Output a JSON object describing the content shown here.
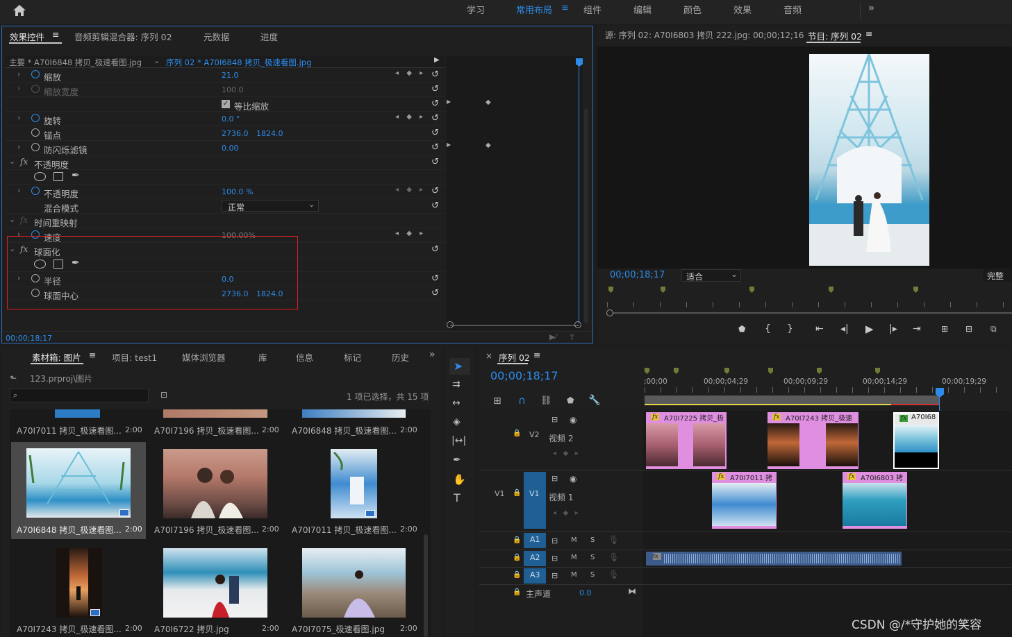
{
  "topbar": {
    "home": "home-icon",
    "workspaces": [
      "学习",
      "常用布局",
      "组件",
      "编辑",
      "颜色",
      "效果",
      "音频"
    ],
    "active": "常用布局",
    "more": "»"
  },
  "effects": {
    "tabs": [
      "效果控件",
      "音频剪辑混合器: 序列 02",
      "元数据",
      "进度"
    ],
    "master": "主要 * A70I6848 拷贝_极速看图.jpg",
    "seq": "序列 02 * A70I6848 拷贝_极速看图.jpg",
    "rows": [
      {
        "label": "缩放",
        "v1": "21.0",
        "v2": ""
      },
      {
        "label": "缩放宽度",
        "v1": "100.0",
        "v2": ""
      },
      {
        "label": "等比缩放",
        "v1": "",
        "v2": ""
      },
      {
        "label": "旋转",
        "v1": "0.0 °",
        "v2": ""
      },
      {
        "label": "锚点",
        "v1": "2736.0",
        "v2": "1824.0"
      },
      {
        "label": "防闪烁滤镜",
        "v1": "0.00",
        "v2": ""
      },
      {
        "label": "不透明度",
        "v1": "",
        "v2": ""
      },
      {
        "label": "",
        "v1": "",
        "v2": ""
      },
      {
        "label": "不透明度",
        "v1": "100.0 %",
        "v2": ""
      },
      {
        "label": "混合模式",
        "v1": "正常",
        "v2": ""
      },
      {
        "label": "时间重映射",
        "v1": "",
        "v2": ""
      },
      {
        "label": "速度",
        "v1": "100.00%",
        "v2": ""
      },
      {
        "label": "球面化",
        "v1": "",
        "v2": ""
      },
      {
        "label": "",
        "v1": "",
        "v2": ""
      },
      {
        "label": "半径",
        "v1": "0.0",
        "v2": ""
      },
      {
        "label": "球面中心",
        "v1": "2736.0",
        "v2": "1824.0"
      }
    ],
    "timecode": "00;00;18;17"
  },
  "source": {
    "title": "源: 序列 02: A70I6803 拷贝 222.jpg: 00;00;12;16"
  },
  "program": {
    "tab": "节目: 序列 02",
    "timecode": "00;00;18;17",
    "fit": "适合",
    "quality": "完整"
  },
  "bin": {
    "tabs": [
      "素材箱: 图片",
      "项目: test1",
      "媒体浏览器",
      "库",
      "信息",
      "标记",
      "历史"
    ],
    "path": "123.prproj\\图片",
    "status": "1 项已选择，共 15 项",
    "items": [
      {
        "name": "A70I7011 拷贝_极速看图...",
        "dur": "2:00"
      },
      {
        "name": "A70I7196 拷贝_极速看图...",
        "dur": "2:00"
      },
      {
        "name": "A70I6848 拷贝_极速看图...",
        "dur": "2:00"
      },
      {
        "name": "A70I6848 拷贝_极速看图...",
        "dur": "2:00"
      },
      {
        "name": "A70I7196 拷贝_极速看图...",
        "dur": "2:00"
      },
      {
        "name": "A70I7011 拷贝_极速看图...",
        "dur": "2:00"
      },
      {
        "name": "A70I7243 拷贝_极速看图...",
        "dur": "2:00"
      },
      {
        "name": "A70I6722 拷贝.jpg",
        "dur": "2:00"
      },
      {
        "name": "A70I7075_极速看图.jpg",
        "dur": "2:00"
      }
    ]
  },
  "timeline": {
    "tab": "序列 02",
    "timecode": "00;00;18;17",
    "ruler": [
      ";00;00",
      "00;00;04;29",
      "00;00;09;29",
      "00;00;14;29",
      "00;00;19;29"
    ],
    "tracks": {
      "v2": "V2",
      "v2name": "视频 2",
      "v1": "V1",
      "v1name": "视频 1",
      "a1": "A1",
      "a2": "A2",
      "a3": "A3",
      "master": "主声道",
      "masterval": "0.0"
    },
    "clips": [
      {
        "label": "A70I7225 拷贝_极"
      },
      {
        "label": "A70I7243 拷贝_极速"
      },
      {
        "label": "A70I68"
      },
      {
        "label": "A70I7011 拷"
      },
      {
        "label": "A70I6803 拷"
      }
    ]
  },
  "watermark": "CSDN @/*守护她的笑容"
}
